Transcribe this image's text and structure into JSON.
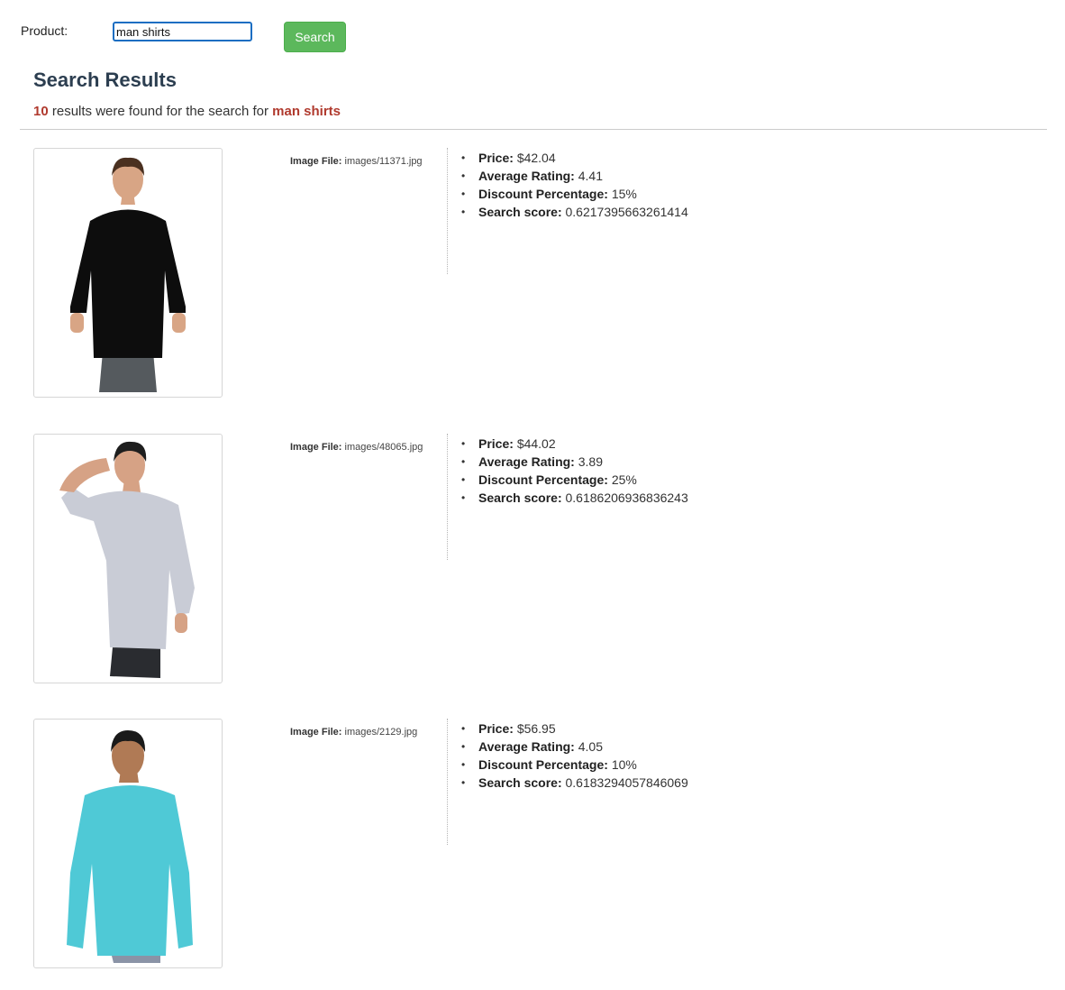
{
  "search": {
    "label": "Product:",
    "value": "man shirts",
    "button_label": "Search"
  },
  "results": {
    "title": "Search Results",
    "count": "10",
    "summary_text": " results were found for the search for ",
    "query": "man shirts",
    "items": [
      {
        "image_label": "Image File:",
        "image_file": "images/11371.jpg",
        "shirt_color": "#0d0d0d",
        "price_label": "Price:",
        "price": "$42.04",
        "rating_label": "Average Rating:",
        "rating": "4.41",
        "discount_label": "Discount Percentage:",
        "discount": "15%",
        "score_label": "Search score:",
        "score": "0.6217395663261414"
      },
      {
        "image_label": "Image File:",
        "image_file": "images/48065.jpg",
        "shirt_color": "#c9ccd6",
        "price_label": "Price:",
        "price": "$44.02",
        "rating_label": "Average Rating:",
        "rating": "3.89",
        "discount_label": "Discount Percentage:",
        "discount": "25%",
        "score_label": "Search score:",
        "score": "0.6186206936836243"
      },
      {
        "image_label": "Image File:",
        "image_file": "images/2129.jpg",
        "shirt_color": "#4fc9d6",
        "price_label": "Price:",
        "price": "$56.95",
        "rating_label": "Average Rating:",
        "rating": "4.05",
        "discount_label": "Discount Percentage:",
        "discount": "10%",
        "score_label": "Search score:",
        "score": "0.6183294057846069"
      }
    ]
  },
  "colors": {
    "accent": "#5cb85c",
    "highlight": "#b03a2e",
    "title": "#2c3e50",
    "input_border": "#1b6ec2"
  }
}
